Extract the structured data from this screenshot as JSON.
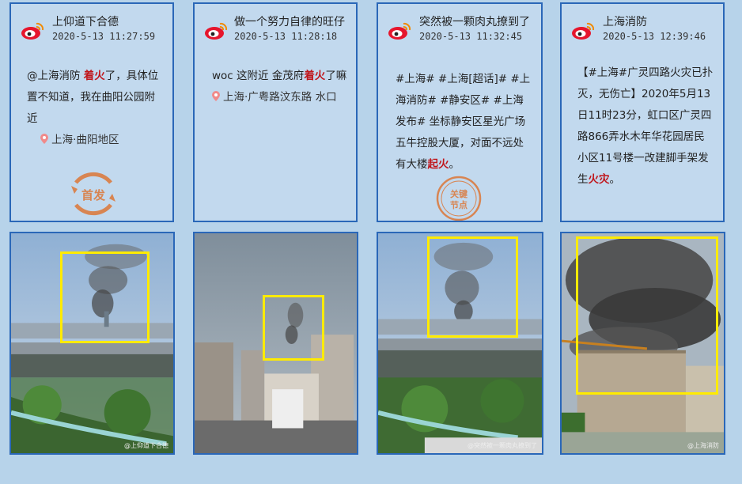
{
  "posts": [
    {
      "username": "上仰道下合德",
      "time": "2020-5-13  11:27:59",
      "body": {
        "p1": "@上海消防 ",
        "hl1": "着火",
        "p2": "了，具体位置不知道，我在曲阳公园附近",
        "location": "上海·曲阳地区"
      },
      "stamp": "首发",
      "watermark": "@上仰道下合德"
    },
    {
      "username": "做一个努力自律的旺仔",
      "time": "2020-5-13  11:28:18",
      "body": {
        "p1": "woc 这附近 金茂府",
        "hl1": "着火",
        "p2": "了嘛",
        "location": "上海·广粤路汶东路    水口"
      }
    },
    {
      "username": "突然被一颗肉丸撩到了",
      "time": "2020-5-13  11:32:45",
      "body": {
        "p1": "#上海# #上海[超话]# #上海消防# #静安区# #上海发布# 坐标静安区星光广场五牛控股大厦，对面不远处有大楼",
        "hl1": "起火",
        "p2": "。"
      },
      "stamp": "关键节点",
      "watermark": "@突然被一颗肉丸撩到了"
    },
    {
      "username": "上海消防",
      "time": "2020-5-13  12:39:46",
      "body": {
        "p1": "【#上海#广灵四路火灾已扑灭，无伤亡】2020年5月13日11时23分，虹口区广灵四路866弄水木年华花园居民小区11号楼一改建脚手架发生",
        "hl1": "火灾",
        "p2": "。"
      },
      "watermark": "@上海消防"
    }
  ],
  "colors": {
    "highlight_text": "#c0161b",
    "card_border": "#2a67b8",
    "highlight_box": "#ffeb00",
    "stamp": "#d88552"
  },
  "icons": [
    "weibo-logo-icon",
    "location-pin-icon"
  ]
}
